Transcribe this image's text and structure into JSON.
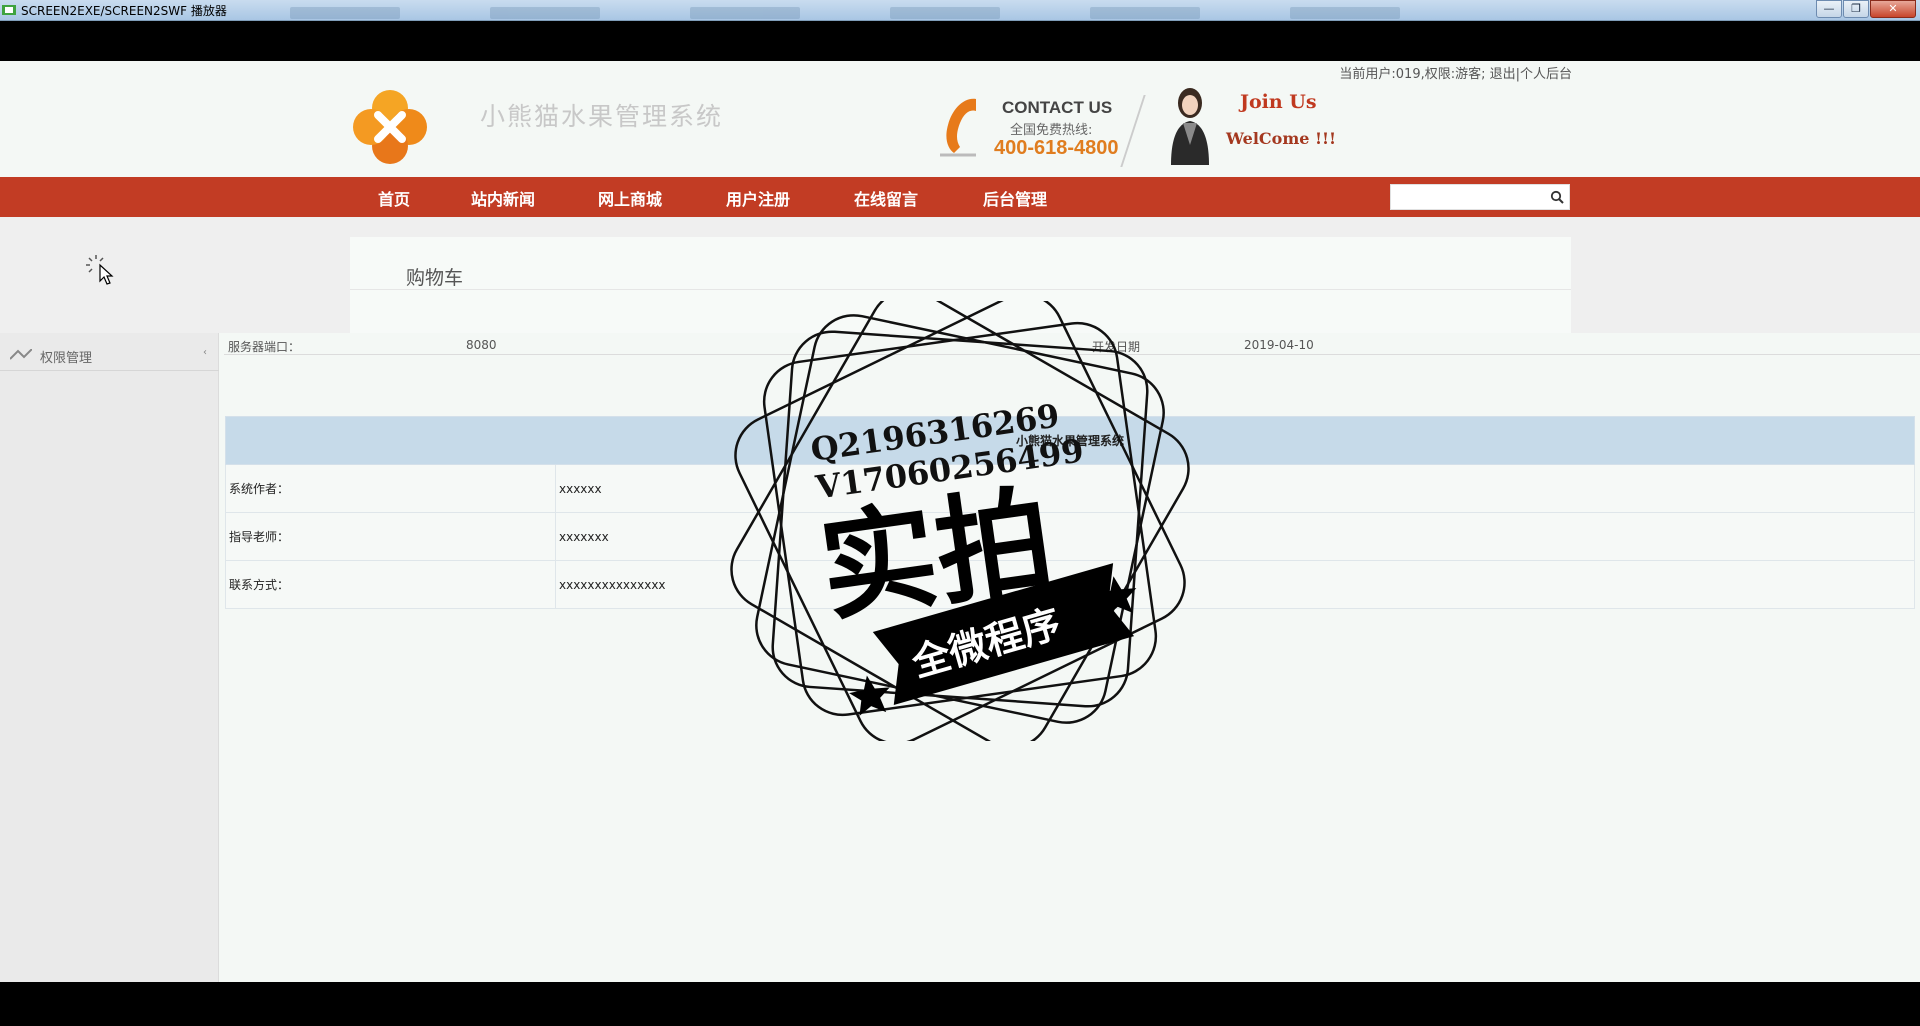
{
  "window": {
    "title": "SCREEN2EXE/SCREEN2SWF 播放器",
    "minimize": "—",
    "maximize": "❐",
    "close": "✕"
  },
  "header": {
    "user_status": "当前用户:019,权限:游客; 退出|个人后台",
    "site_name": "小熊猫水果管理系统",
    "contact_title": "CONTACT US",
    "contact_sub": "全国免费热线:",
    "contact_phone": "400-618-4800",
    "join": "Join Us",
    "welcome": "WelCome !!!"
  },
  "nav": {
    "items": [
      "首页",
      "站内新闻",
      "网上商城",
      "用户注册",
      "在线留言",
      "后台管理"
    ],
    "search_placeholder": ""
  },
  "card": {
    "title": "购物车"
  },
  "sidebar": {
    "item_label": "权限管理",
    "arrow": "‹"
  },
  "top_row": {
    "c1": "服务器端口：",
    "c2": "8080",
    "c3": "开发日期",
    "c4": "2019-04-10"
  },
  "info": {
    "header": "小熊猫水果管理系统",
    "rows": [
      {
        "label": "系统作者：",
        "value": "xxxxxx"
      },
      {
        "label": "指导老师：",
        "value": "xxxxxxx"
      },
      {
        "label": "联系方式：",
        "value": "xxxxxxxxxxxxxxx"
      }
    ]
  },
  "watermark": {
    "q": "Q2196316269",
    "v": "V17060256499",
    "big": "实拍",
    "banner": "全微程序"
  },
  "colors": {
    "nav_red": "#c23c24",
    "accent_orange": "#e07d1f",
    "table_header": "#c6dae9"
  }
}
